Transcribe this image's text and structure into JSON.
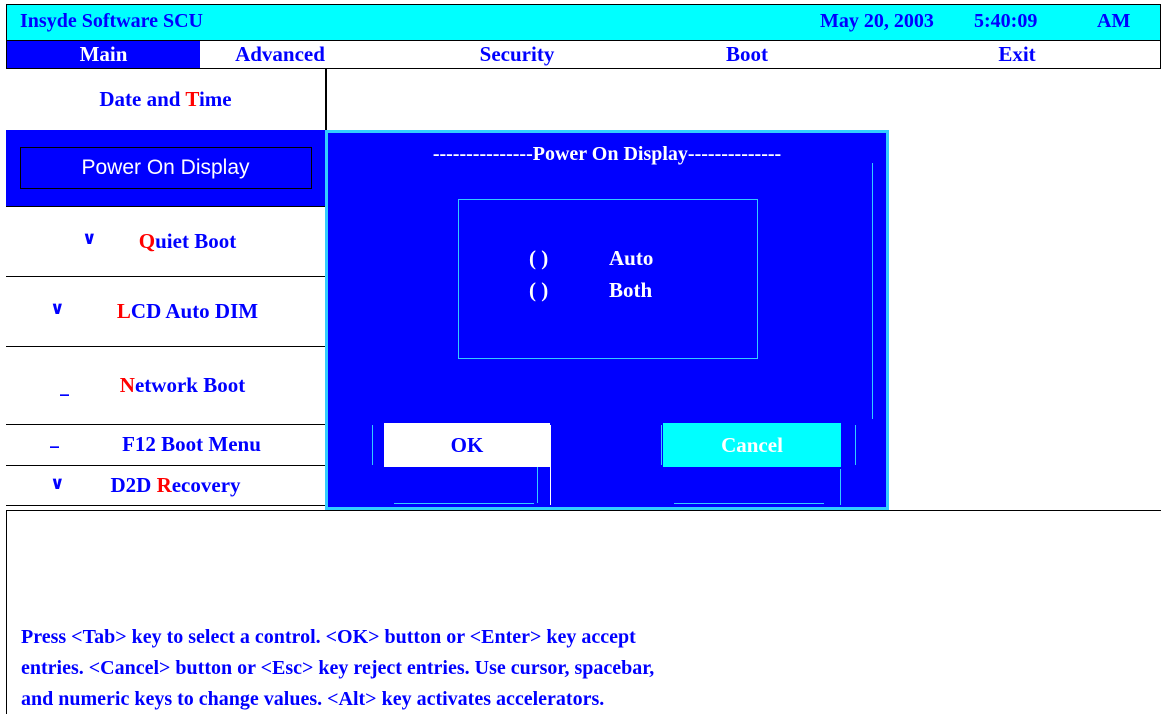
{
  "titlebar": {
    "app_name": "Insyde Software SCU",
    "date": "May 20, 2003",
    "time": "5:40:09",
    "ampm": "AM"
  },
  "menu": {
    "tabs": [
      {
        "label": "Main"
      },
      {
        "label": "Advanced"
      },
      {
        "label": "Security"
      },
      {
        "label": "Boot"
      },
      {
        "label": "Exit"
      }
    ]
  },
  "sidebar": {
    "items": [
      {
        "prefix": "Date and ",
        "hot": "T",
        "rest": "ime",
        "check": ""
      },
      {
        "label": "Power On Display",
        "check": ""
      },
      {
        "prefix": "",
        "hot": "Q",
        "rest": "uiet Boot",
        "check": "∨"
      },
      {
        "prefix": "",
        "hot": "L",
        "rest": "CD Auto DIM",
        "check": "∨"
      },
      {
        "prefix": "",
        "hot": "N",
        "rest": "etwork Boot",
        "check": "_"
      },
      {
        "prefix": "F12 Boot Menu",
        "hot": "",
        "rest": "",
        "check": "_"
      },
      {
        "prefix": "D2D ",
        "hot": "R",
        "rest": "ecovery",
        "check": "∨"
      }
    ]
  },
  "dialog": {
    "title": "---------------Power On Display--------------",
    "options": [
      {
        "radio": "(   )",
        "label": "Auto"
      },
      {
        "radio": "(   )",
        "label": "Both"
      }
    ],
    "ok_label": "OK",
    "cancel_label": "Cancel"
  },
  "help": {
    "lines": [
      "Press <Tab> key to select a control. <OK> button or <Enter> key accept",
      "entries. <Cancel> button or <Esc> key reject entries. Use cursor, spacebar,",
      "and numeric keys to change values. <Alt> key activates accelerators."
    ]
  },
  "colors": {
    "titlebar_bg": "#00ffff",
    "accent_blue": "#0000ff",
    "hotkey_red": "#ff0000",
    "dialog_border": "#33ccff"
  }
}
